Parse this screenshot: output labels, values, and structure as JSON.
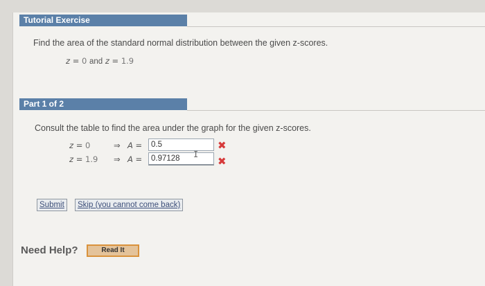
{
  "tutorial": {
    "header": "Tutorial Exercise",
    "instruction": "Find the area of the standard normal distribution between the given z-scores.",
    "given": {
      "z1_var": "z",
      "z1_val": "0",
      "conj": "and",
      "z2_var": "z",
      "z2_val": "1.9",
      "eq": "="
    }
  },
  "part": {
    "header": "Part 1 of 2",
    "instruction": "Consult the table to find the area under the graph for the given z-scores.",
    "rows": [
      {
        "z_var": "z",
        "eq": "=",
        "z_val": "0",
        "arrow": "⇒",
        "a_var": "A",
        "a_eq": "=",
        "answer": "0.5",
        "status": "✖"
      },
      {
        "z_var": "z",
        "eq": "=",
        "z_val": "1.9",
        "arrow": "⇒",
        "a_var": "A",
        "a_eq": "=",
        "answer": "0.97128",
        "status": "✖"
      }
    ]
  },
  "buttons": {
    "submit": "Submit",
    "skip": "Skip (you cannot come back)"
  },
  "help": {
    "label": "Need Help?",
    "read_it": "Read It"
  },
  "colors": {
    "section_bar": "#5b80a8",
    "error": "#d63a3a",
    "read_button_border": "#d9923c"
  }
}
